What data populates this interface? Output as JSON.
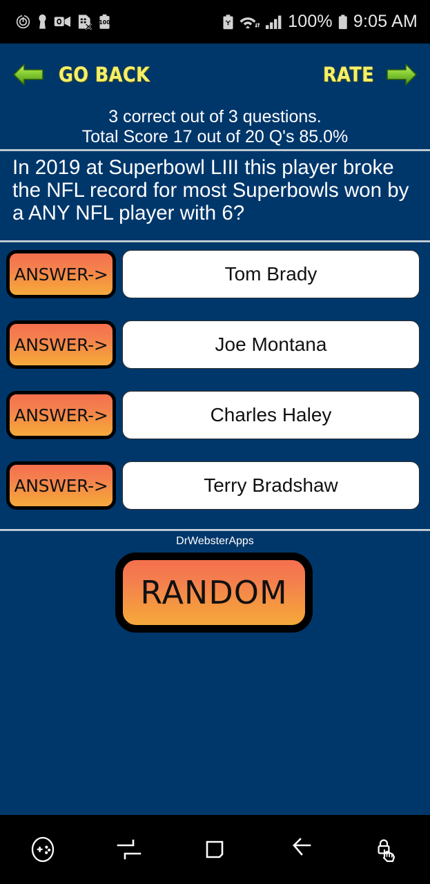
{
  "status_bar": {
    "left_icons": [
      {
        "name": "alarm-icon"
      },
      {
        "name": "keyhole-icon"
      },
      {
        "name": "outlook-video-icon"
      },
      {
        "name": "sim-card-error-icon"
      },
      {
        "name": "battery-100-badge-icon"
      }
    ],
    "right_icons": [
      {
        "name": "battery-saver-icon"
      },
      {
        "name": "wifi-icon"
      },
      {
        "name": "cellular-signal-icon"
      }
    ],
    "battery_percent": "100%",
    "time": "9:05 AM"
  },
  "top_nav": {
    "go_back_label": "GO BACK",
    "rate_label": "RATE",
    "arrow_color": "#7ac943",
    "label_color": "#f5f06a"
  },
  "score": {
    "line1": "3 correct out of 3 questions.",
    "line2": "Total Score 17 out of 20 Q's  85.0%",
    "correct": 3,
    "total_questions": 3,
    "total_score": 17,
    "total_possible": 20,
    "percent": "85.0%"
  },
  "question": {
    "text": "In 2019 at Superbowl LIII this player broke the NFL record for most Superbowls won by a ANY NFL player with 6?"
  },
  "answers": [
    {
      "button_label": "ANSWER->",
      "text": "Tom Brady"
    },
    {
      "button_label": "ANSWER->",
      "text": "Joe Montana"
    },
    {
      "button_label": "ANSWER->",
      "text": "Charles Haley"
    },
    {
      "button_label": "ANSWER->",
      "text": "Terry Bradshaw"
    }
  ],
  "footer": {
    "brand": "DrWebsterApps",
    "random_label": "RANDOM"
  },
  "bottom_nav": {
    "items": [
      {
        "name": "game-launcher-icon"
      },
      {
        "name": "switch-windows-icon"
      },
      {
        "name": "home-icon"
      },
      {
        "name": "back-icon"
      },
      {
        "name": "screen-pin-lock-icon"
      }
    ]
  },
  "theme": {
    "background": "#00376b",
    "button_gradient_top": "#f4704e",
    "button_gradient_bottom": "#f5a93d",
    "nav_bar": "#000000"
  }
}
